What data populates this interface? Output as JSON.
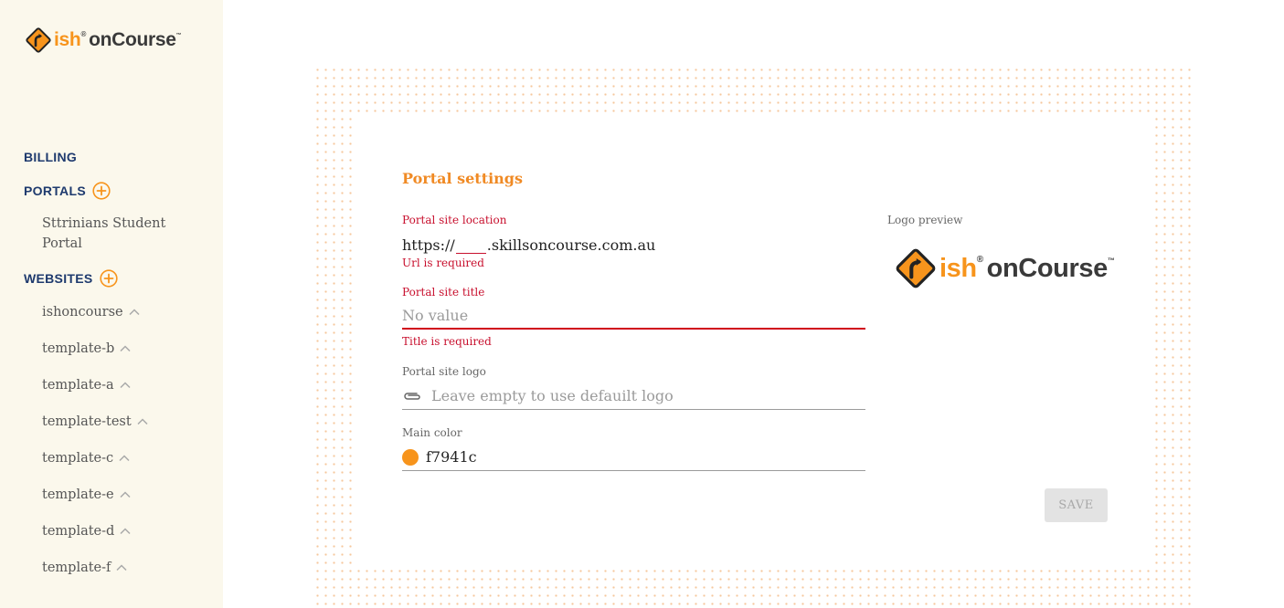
{
  "brand": {
    "name_ish": "ish",
    "name_reg": "®",
    "name_course": "onCourse",
    "name_tm": "™",
    "accent": "#f7941c"
  },
  "sidebar": {
    "billing": "BILLING",
    "portals": {
      "label": "PORTALS",
      "items": [
        "Sttrinians Student Portal"
      ]
    },
    "websites": {
      "label": "WEBSITES",
      "items": [
        "ishoncourse",
        "template-b",
        "template-a",
        "template-test",
        "template-c",
        "template-e",
        "template-d",
        "template-f"
      ]
    }
  },
  "form": {
    "title": "Portal settings",
    "location": {
      "label": "Portal site location",
      "prefix": "https://",
      "suffix": ".skillsoncourse.com.au",
      "error": "Url is required"
    },
    "site_title": {
      "label": "Portal site title",
      "placeholder": "No value",
      "error": "Title is required"
    },
    "logo": {
      "label": "Portal site logo",
      "placeholder": "Leave empty to use defauilt logo"
    },
    "main_color": {
      "label": "Main color",
      "value": "f7941c",
      "swatch": "#f7941c"
    },
    "save_label": "SAVE"
  },
  "preview": {
    "label": "Logo preview"
  },
  "icons": {
    "plus": "plus-circle-icon",
    "chevron": "chevron-up-icon",
    "clip": "paperclip-icon",
    "logo": "road-sign-logo-icon"
  }
}
